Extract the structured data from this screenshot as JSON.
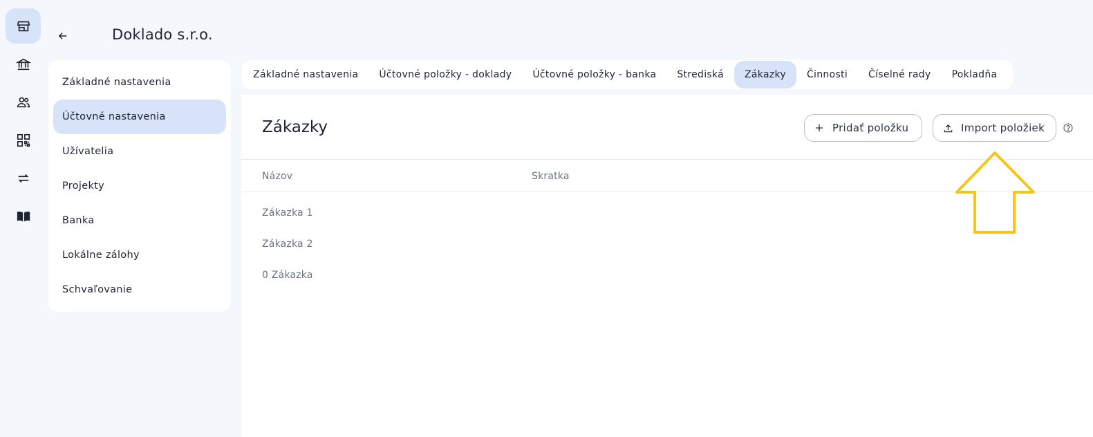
{
  "rail": {
    "items": [
      {
        "icon": "store-icon",
        "active": true
      },
      {
        "icon": "bank-icon",
        "active": false
      },
      {
        "icon": "users-icon",
        "active": false
      },
      {
        "icon": "qr-code-icon",
        "active": false
      },
      {
        "icon": "transfer-icon",
        "active": false
      },
      {
        "icon": "book-icon",
        "active": false
      }
    ]
  },
  "header": {
    "back_icon": "arrow-left-icon",
    "company_name": "Doklado s.r.o."
  },
  "sidebar": {
    "items": [
      {
        "label": "Základné nastavenia",
        "active": false
      },
      {
        "label": "Účtovné nastavenia",
        "active": true
      },
      {
        "label": "Užívatelia",
        "active": false
      },
      {
        "label": "Projekty",
        "active": false
      },
      {
        "label": "Banka",
        "active": false
      },
      {
        "label": "Lokálne zálohy",
        "active": false
      },
      {
        "label": "Schvaľovanie",
        "active": false
      }
    ]
  },
  "tabs": [
    {
      "label": "Základné nastavenia",
      "active": false
    },
    {
      "label": "Účtovné položky - doklady",
      "active": false
    },
    {
      "label": "Účtovné položky - banka",
      "active": false
    },
    {
      "label": "Strediská",
      "active": false
    },
    {
      "label": "Zákazky",
      "active": true
    },
    {
      "label": "Činnosti",
      "active": false
    },
    {
      "label": "Číselné rady",
      "active": false
    },
    {
      "label": "Pokladňa",
      "active": false
    }
  ],
  "main": {
    "title": "Zákazky",
    "add_button": {
      "label": "Pridať položku",
      "icon": "plus-icon"
    },
    "import_button": {
      "label": "Import položiek",
      "icon": "upload-icon"
    },
    "help_icon": "help-circle-icon",
    "table": {
      "columns": [
        "Názov",
        "Skratka"
      ],
      "rows": [
        {
          "name": "Zákazka 1",
          "short": ""
        },
        {
          "name": "Zákazka 2",
          "short": ""
        },
        {
          "name": "0 Zákazka",
          "short": ""
        }
      ]
    }
  },
  "annotation": {
    "arrow_color": "#f5c518"
  },
  "colors": {
    "active_bg": "#d6e3f8",
    "page_bg": "#f4f7fb"
  }
}
